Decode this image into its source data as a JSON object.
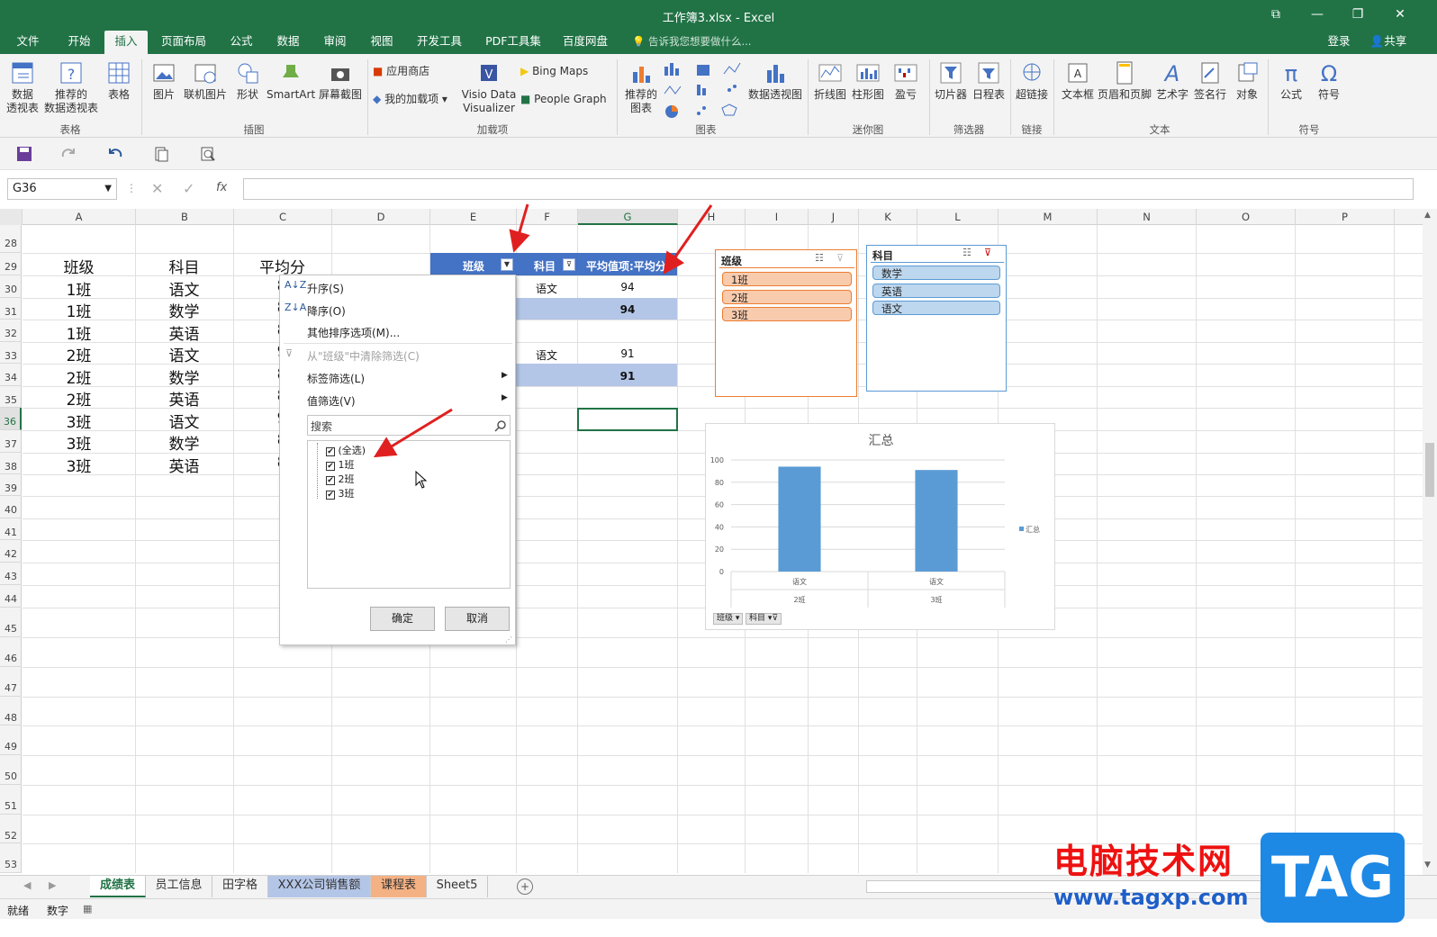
{
  "window": {
    "title": "工作簿3.xlsx - Excel",
    "minimize": "—",
    "restore": "❐",
    "maximize": "☐",
    "close": "✕",
    "ribbon_toggle": "⧉"
  },
  "tabs": [
    "文件",
    "开始",
    "插入",
    "页面布局",
    "公式",
    "数据",
    "审阅",
    "视图",
    "开发工具",
    "PDF工具集",
    "百度网盘"
  ],
  "tell_me": "告诉我您想要做什么...",
  "login": "登录",
  "share": "共享",
  "ribbon": {
    "pivot": "数据\n透视表",
    "rec_pivot": "推荐的\n数据透视表",
    "table": "表格",
    "g_tables": "表格",
    "picture": "图片",
    "online_pic": "联机图片",
    "shapes": "形状",
    "smartart": "SmartArt",
    "screenshot": "屏幕截图",
    "g_illus": "插图",
    "store": "应用商店",
    "my_addins": "我的加载项",
    "visio": "Visio Data\nVisualizer",
    "bing": "Bing Maps",
    "people": "People Graph",
    "g_addins": "加载项",
    "rec_charts": "推荐的\n图表",
    "pivot_chart": "数据透视图",
    "g_charts": "图表",
    "spark_line": "折线图",
    "spark_col": "柱形图",
    "spark_wl": "盈亏",
    "g_spark": "迷你图",
    "slicer": "切片器",
    "timeline": "日程表",
    "g_filter": "筛选器",
    "hyperlink": "超链接",
    "g_links": "链接",
    "textbox": "文本框",
    "headerfooter": "页眉和页脚",
    "wordart": "艺术字",
    "signature": "签名行",
    "object": "对象",
    "g_text": "文本",
    "equation": "公式",
    "symbol": "符号",
    "g_symbols": "符号"
  },
  "namebox": "G36",
  "fx": "fx",
  "columns": [
    "A",
    "B",
    "C",
    "D",
    "E",
    "F",
    "G",
    "H",
    "I",
    "J",
    "K",
    "L",
    "M",
    "N",
    "O",
    "P"
  ],
  "rows": [
    "28",
    "29",
    "30",
    "31",
    "32",
    "33",
    "34",
    "35",
    "36",
    "37",
    "38",
    "39",
    "40",
    "41",
    "42",
    "43",
    "44",
    "45",
    "46",
    "47",
    "48",
    "49",
    "50",
    "51",
    "52",
    "53"
  ],
  "table_header": {
    "class": "班级",
    "subject": "科目",
    "avg": "平均分"
  },
  "table_rows": [
    [
      "1班",
      "语文",
      "8"
    ],
    [
      "1班",
      "数学",
      "8"
    ],
    [
      "1班",
      "英语",
      "8"
    ],
    [
      "2班",
      "语文",
      "9"
    ],
    [
      "2班",
      "数学",
      "8"
    ],
    [
      "2班",
      "英语",
      "8"
    ],
    [
      "3班",
      "语文",
      "9"
    ],
    [
      "3班",
      "数学",
      "8"
    ],
    [
      "3班",
      "英语",
      "8"
    ]
  ],
  "pivot": {
    "h_class": "班级",
    "h_subject": "科目",
    "h_value": "平均值项:平均分",
    "r1_subject": "语文",
    "r1_value": "94",
    "r1_total": "94",
    "r2_subject": "语文",
    "r2_value": "91",
    "r2_total": "91"
  },
  "menu": {
    "asc": "升序(S)",
    "desc": "降序(O)",
    "more_sort": "其他排序选项(M)...",
    "clear": "从\"班级\"中清除筛选(C)",
    "label_filter": "标签筛选(L)",
    "value_filter": "值筛选(V)",
    "search_ph": "搜索",
    "all": "(全选)",
    "items": [
      "1班",
      "2班",
      "3班"
    ],
    "ok": "确定",
    "cancel": "取消"
  },
  "slicer_class": {
    "title": "班级",
    "items": [
      "1班",
      "2班",
      "3班"
    ],
    "color": "#f8cbad",
    "border": "#ed7d31"
  },
  "slicer_subject": {
    "title": "科目",
    "items": [
      "数学",
      "英语",
      "语文"
    ],
    "color": "#bdd7ee",
    "border": "#5b9bd5"
  },
  "chart_data": {
    "type": "bar",
    "title": "汇总",
    "categories": [
      "语文",
      "语文"
    ],
    "groups": [
      "2班",
      "3班"
    ],
    "series": [
      {
        "name": "汇总",
        "values": [
          94,
          91
        ]
      }
    ],
    "ylim": [
      0,
      100
    ],
    "yticks": [
      "0",
      "20",
      "40",
      "60",
      "80",
      "100"
    ],
    "field_buttons": [
      "班级",
      "科目"
    ],
    "bar_color": "#5b9bd5"
  },
  "sheets": [
    "成绩表",
    "员工信息",
    "田字格",
    "XXX公司销售额",
    "课程表",
    "Sheet5"
  ],
  "status": {
    "ready": "就绪",
    "numlock": "数字"
  },
  "watermark": {
    "cn": "电脑技术网",
    "url": "www.tagxp.com",
    "tag": "TAG"
  }
}
